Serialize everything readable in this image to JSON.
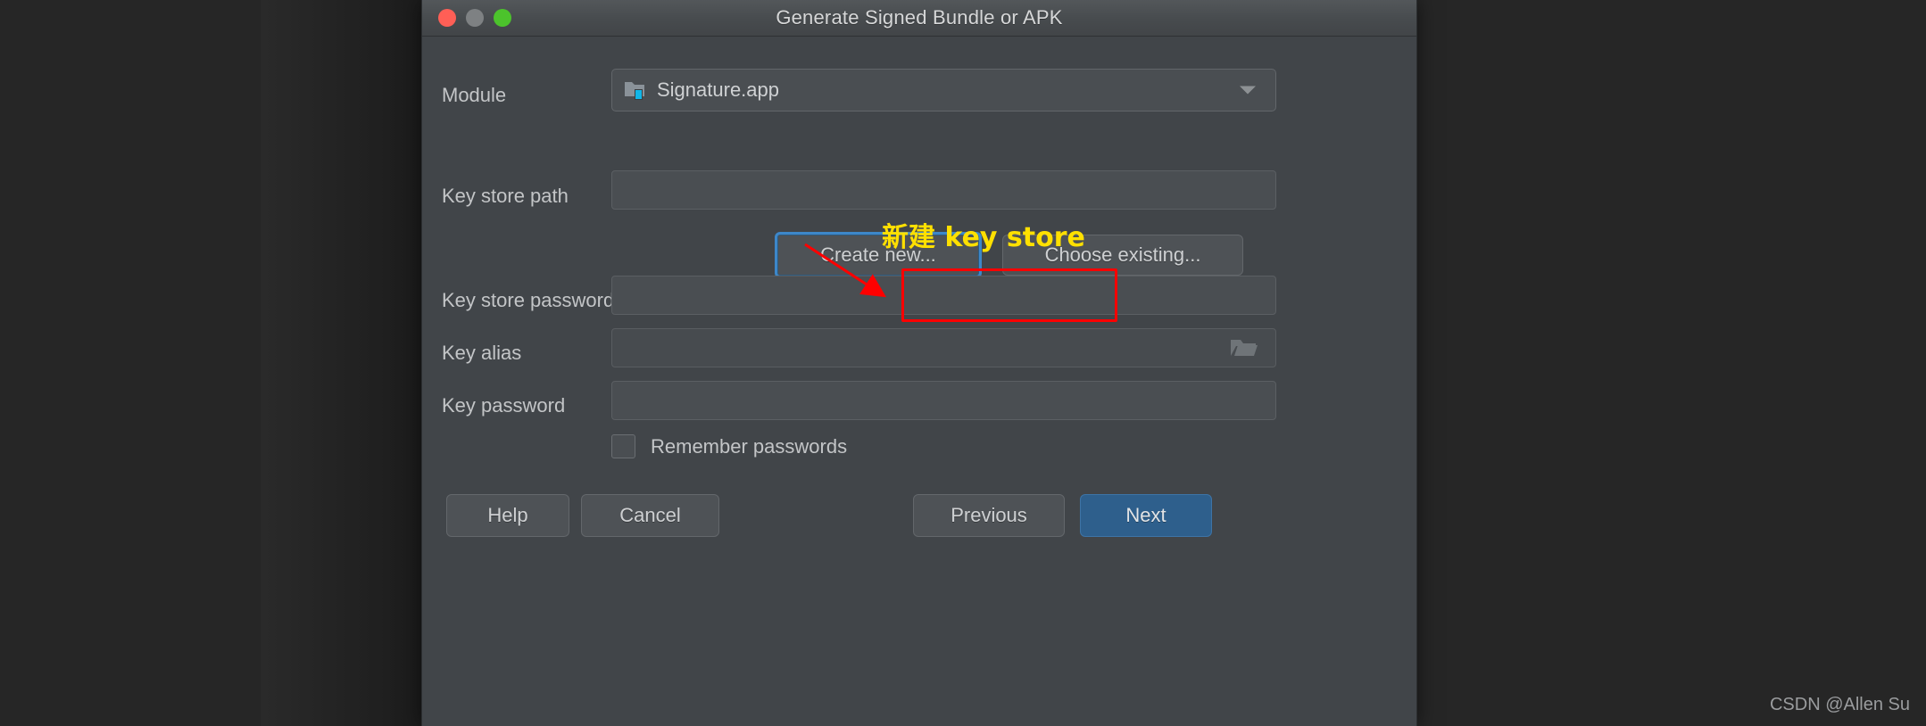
{
  "window": {
    "title": "Generate Signed Bundle or APK",
    "traffic_lights": [
      {
        "name": "close",
        "color": "#ff5f56"
      },
      {
        "name": "minimize",
        "color": "#7e8183"
      },
      {
        "name": "zoom",
        "color": "#4cc32c"
      }
    ]
  },
  "form": {
    "module": {
      "label": "Module",
      "value": "Signature.app",
      "icon": "android-module-folder-icon",
      "caret": "chevron-down-icon"
    },
    "key_store_path": {
      "label": "Key store path",
      "value": "",
      "placeholder": ""
    },
    "key_store_password": {
      "label": "Key store password",
      "value": "",
      "placeholder": ""
    },
    "key_alias": {
      "label": "Key alias",
      "value": "",
      "placeholder": "",
      "icon": "open-folder-icon"
    },
    "key_password": {
      "label": "Key password",
      "value": "",
      "placeholder": ""
    },
    "remember_passwords": {
      "label": "Remember passwords",
      "checked": false
    }
  },
  "keystore_actions": {
    "create_new": "Create new...",
    "choose_existing": "Choose existing..."
  },
  "footer": {
    "help": "Help",
    "cancel": "Cancel",
    "previous": "Previous",
    "next": "Next"
  },
  "annotations": {
    "note_text": "新建 key store",
    "note_color": "#ffe000",
    "highlight_color": "#ff0000",
    "focus_color": "#3d87c9"
  },
  "watermark": "CSDN @Allen Su",
  "colors": {
    "dialog_bg": "#414549",
    "titlebar_bg": "#474b4e",
    "field_bg": "#4a4e52",
    "accent_button": "#2e5f8c",
    "text": "#c3c5c7"
  }
}
